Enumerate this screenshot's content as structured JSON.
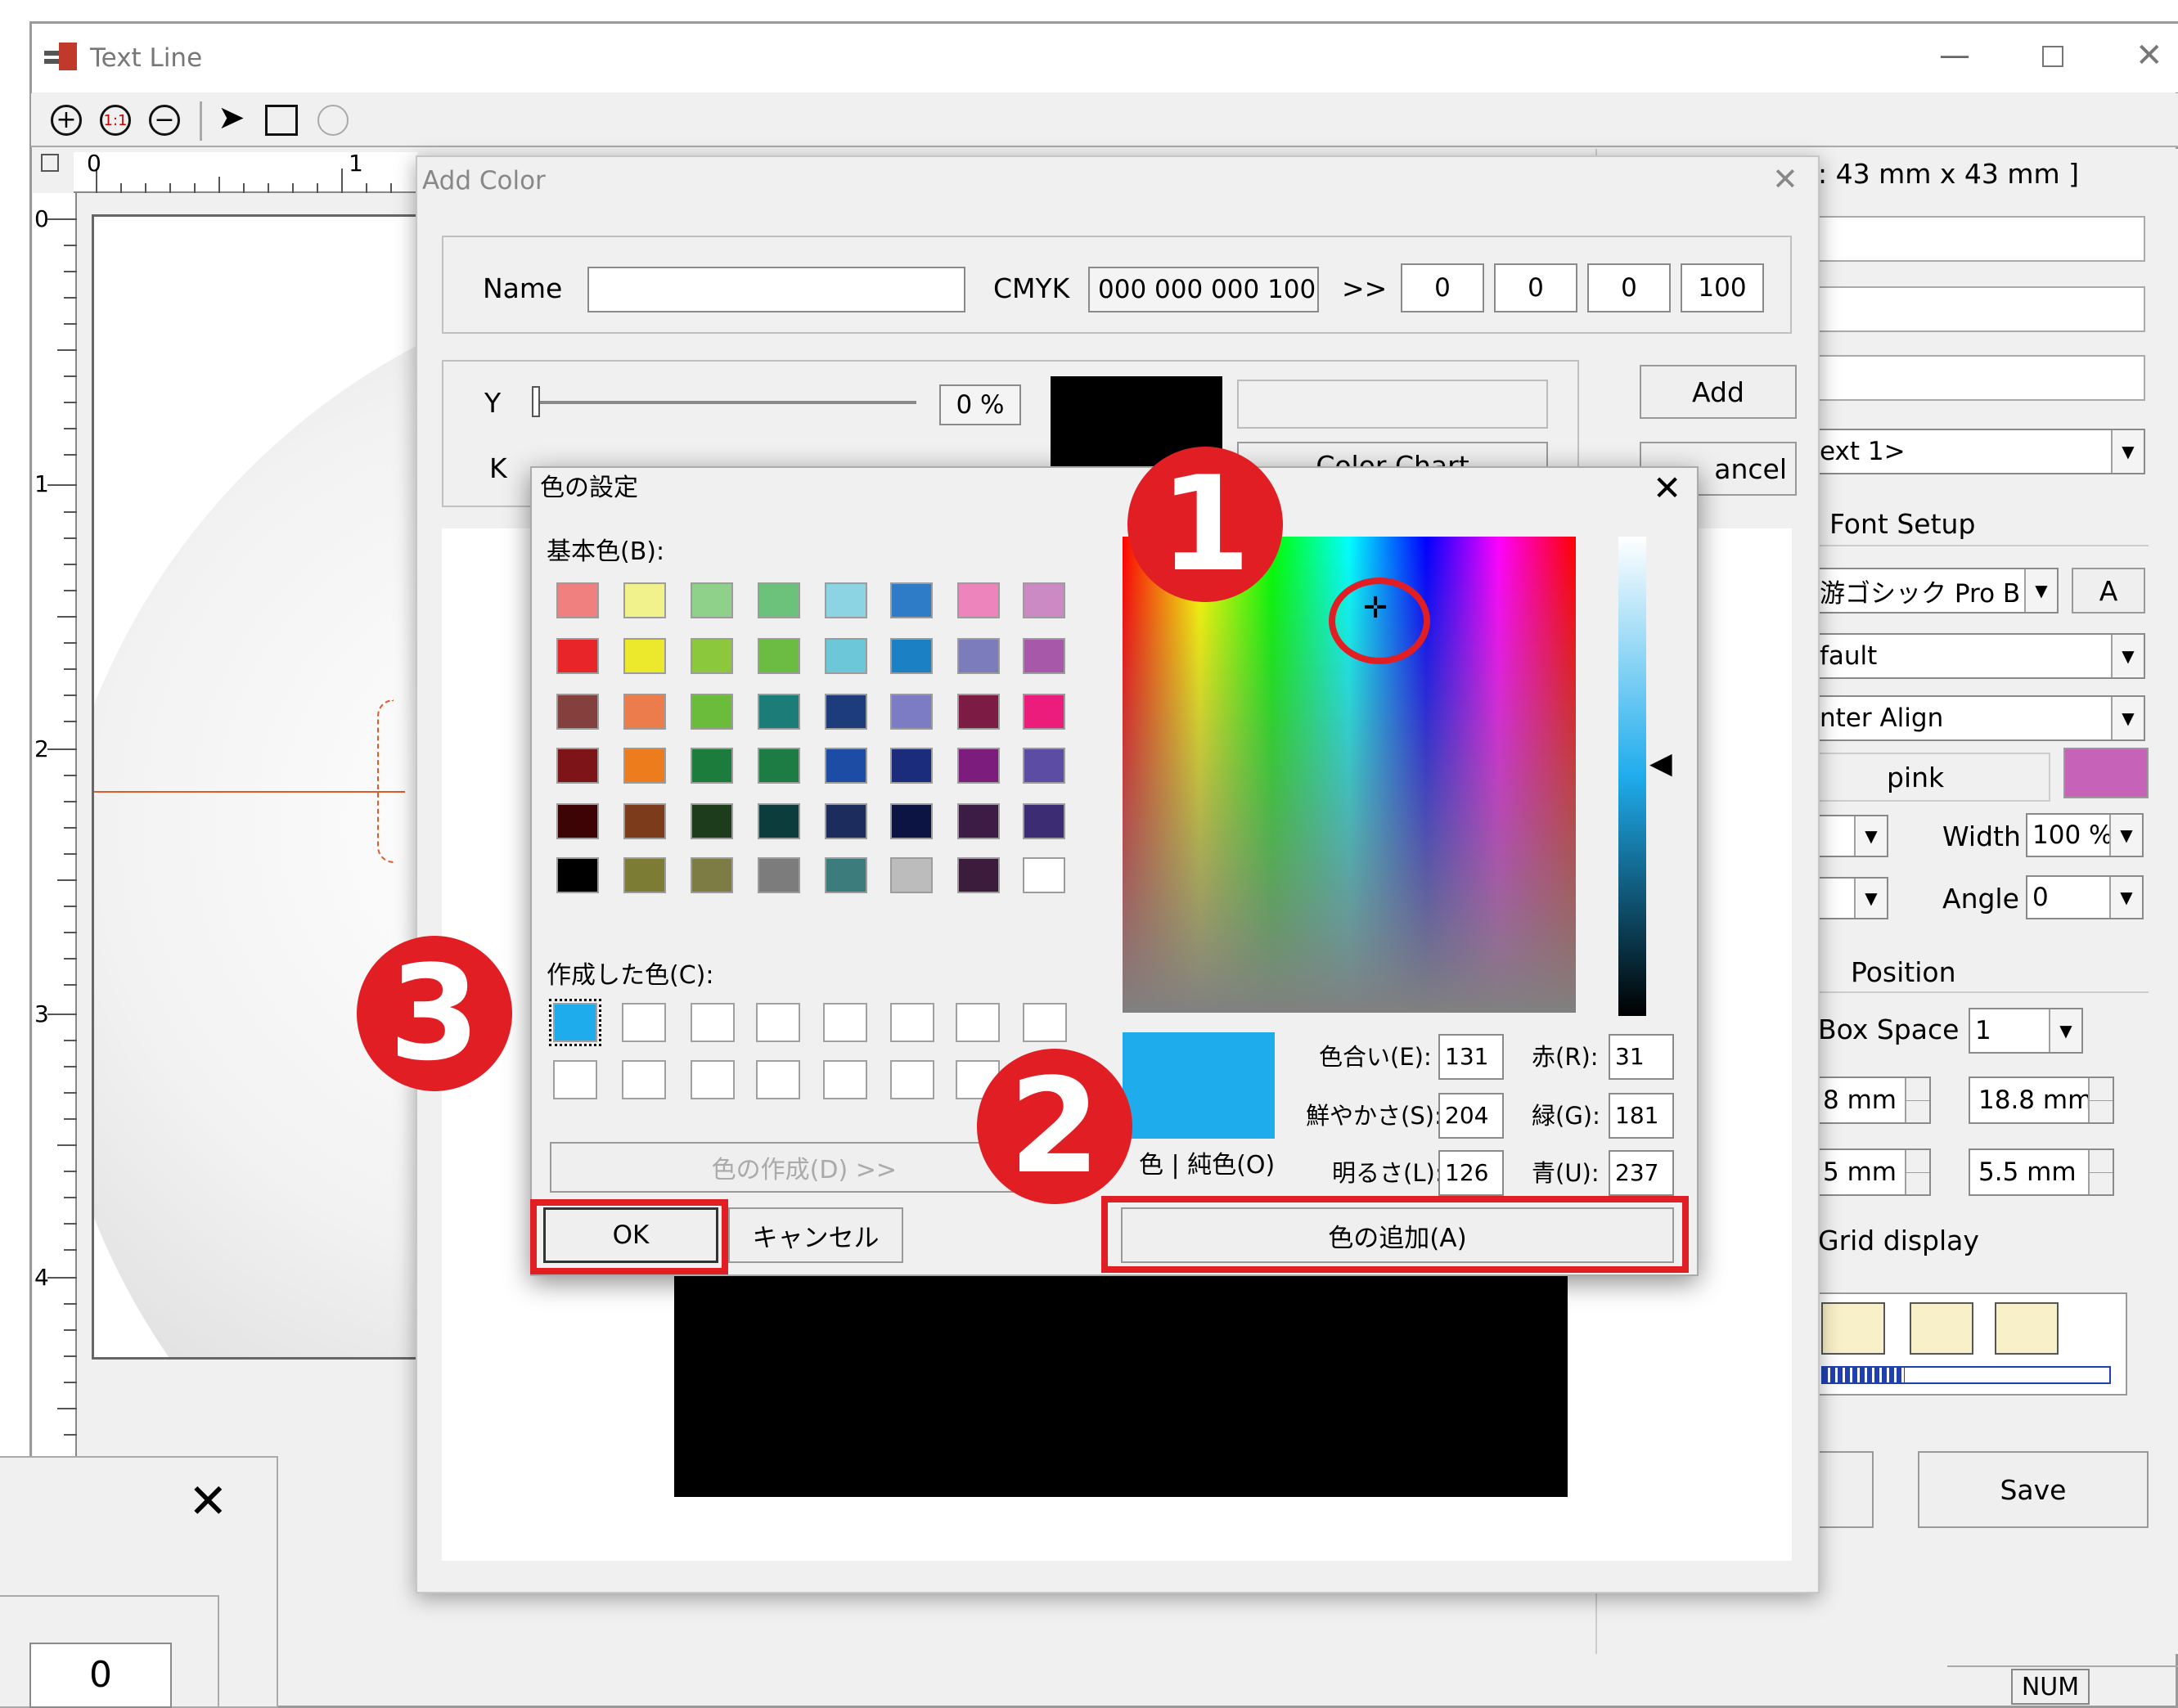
{
  "textline": {
    "title": "Text Line",
    "size_label": ": 43 mm x 43 mm ]",
    "ruler_h": [
      "0",
      "1"
    ],
    "ruler_v": [
      "0",
      "1",
      "2",
      "3",
      "4"
    ]
  },
  "rightpanel": {
    "text_dropdown": "ext 1>",
    "font_setup": "Font Setup",
    "font": "游ゴシック Pro B",
    "font_btn": "A",
    "style": "fault",
    "align": "nter Align",
    "color_name": "pink",
    "color_swatch": "#c663b8",
    "width_label": "Width",
    "width_value": "100 %",
    "angle_label": "Angle",
    "angle_value": "0",
    "position": "Position",
    "box_space_label": "Box Space",
    "box_space_value": "1",
    "x1": "8 mm",
    "x2": "18.8 mm",
    "y1": "5 mm",
    "y2": "5.5 mm",
    "grid_display": "Grid display",
    "save": "Save",
    "status_num": "NUM"
  },
  "addcolor": {
    "title": "Add Color",
    "name_label": "Name",
    "name_value": "",
    "cmyk_label": "CMYK",
    "cmyk_value": "000 000 000 100",
    "arrow": ">>",
    "c": "0",
    "m": "0",
    "y": "0",
    "k": "100",
    "y_label": "Y",
    "k_label": "K",
    "y_percent": "0 %",
    "add": "Add",
    "cancel": "ancel",
    "color_chart": "Color Chart"
  },
  "colordlg": {
    "title": "色の設定",
    "basic_label": "基本色(B):",
    "custom_label": "作成した色(C):",
    "define_btn": "色の作成(D) >>",
    "ok": "OK",
    "cancel": "キャンセル",
    "add_custom": "色の追加(A)",
    "color_solid": "色 | 純色(O)",
    "hue_label": "色合い(E):",
    "hue": "131",
    "sat_label": "鮮やかさ(S):",
    "sat": "204",
    "lum_label": "明るさ(L):",
    "lum": "126",
    "red_label": "赤(R):",
    "red": "31",
    "green_label": "緑(G):",
    "green": "181",
    "blue_label": "青(U):",
    "blue": "237",
    "selected_color": "#1facec",
    "basic_colors": [
      "#f08080",
      "#f2f28c",
      "#8fd08a",
      "#6cc27a",
      "#8cd4e4",
      "#2e7cc8",
      "#ee84bc",
      "#cc8ac4",
      "#e8262a",
      "#ece82c",
      "#8cc83c",
      "#6cbc44",
      "#6cc8d8",
      "#1c80c4",
      "#7c7cbc",
      "#a858a8",
      "#84403c",
      "#ec7c4c",
      "#6cbc3c",
      "#1c7c78",
      "#1c3c7c",
      "#7c7cc4",
      "#7c1c44",
      "#ec1c7c",
      "#7c1418",
      "#ec7c1c",
      "#1c7c3c",
      "#1c7c44",
      "#1c4ca4",
      "#1c2c7c",
      "#7c1c7c",
      "#5c4ca4",
      "#3c0404",
      "#7c3c1c",
      "#1c3c1c",
      "#0c3c3c",
      "#1c2c5c",
      "#0c1444",
      "#3c1c44",
      "#3c2c74",
      "#000000",
      "#7c7c34",
      "#7c7c44",
      "#7c7c7c",
      "#3c7c7c",
      "#bcbcbc",
      "#3c1c3c",
      "#ffffff"
    ]
  },
  "bottomleft": {
    "value": "0"
  },
  "annotations": {
    "one": "1",
    "two": "2",
    "three": "3"
  }
}
